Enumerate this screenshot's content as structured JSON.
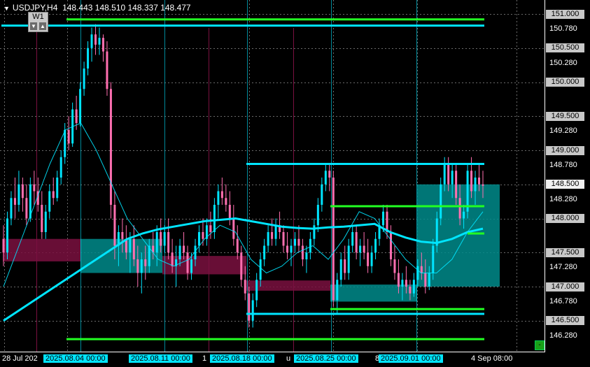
{
  "header": {
    "symbol": "USDJPY,H4",
    "ohlc": "148.443 148.510 148.337 148.477"
  },
  "timeframe_button": {
    "label": "W1",
    "down": "▼",
    "up": "▲"
  },
  "price_axis": {
    "boxed": [
      "151.000",
      "150.500",
      "150.000",
      "149.500",
      "149.000",
      "148.500",
      "148.000",
      "147.500",
      "147.000",
      "146.500"
    ],
    "plain": [
      "150.780",
      "150.280",
      "149.280",
      "148.780",
      "148.280",
      "147.280",
      "146.780",
      "146.280"
    ],
    "current": "148.500"
  },
  "time_axis": {
    "labels": [
      {
        "text": "28 Jul 202",
        "highlight": false
      },
      {
        "text": "2025.08.04 00:00",
        "highlight": true
      },
      {
        "text": "2025.08.11 00:00",
        "highlight": true
      },
      {
        "text": "1",
        "highlight": false
      },
      {
        "text": "2025.08.18 00:00",
        "highlight": true
      },
      {
        "text": "u",
        "highlight": false
      },
      {
        "text": "2025.08.25 00:00",
        "highlight": true
      },
      {
        "text": "8",
        "highlight": false
      },
      {
        "text": "2025.09.01 00:00",
        "highlight": true
      },
      {
        "text": "4 Sep 08:00",
        "highlight": false
      }
    ]
  },
  "corner_button": {
    "label": "-"
  },
  "colors": {
    "background": "#000000",
    "bull": "#00e5ff",
    "bear": "#ff6fb0",
    "support": "#22ff22",
    "box_teal": "#008b8b",
    "box_maroon": "#7a1040"
  },
  "chart_data": {
    "type": "candlestick",
    "symbol": "USDJPY",
    "timeframe": "H4",
    "ylim": [
      146.1,
      151.1
    ],
    "vertical_markers": [
      "2025.08.04 00:00",
      "2025.08.11 00:00",
      "2025.08.18 00:00",
      "2025.08.25 00:00",
      "2025.09.01 00:00"
    ],
    "horizontal_lines": [
      {
        "color": "#00e5ff",
        "price": 150.83
      },
      {
        "color": "#22ff22",
        "price": 150.92
      },
      {
        "color": "#00e5ff",
        "price": 148.8
      },
      {
        "color": "#00e5ff",
        "price": 146.6
      },
      {
        "color": "#22ff22",
        "price": 148.18
      },
      {
        "color": "#22ff22",
        "price": 147.78
      },
      {
        "color": "#22ff22",
        "price": 146.67
      },
      {
        "color": "#22ff22",
        "price": 146.23
      }
    ],
    "zones": [
      {
        "color": "#7a1040",
        "top": 147.7,
        "bottom": 147.37
      },
      {
        "color": "#008b8b",
        "top": 147.7,
        "bottom": 147.2
      },
      {
        "color": "#7a1040",
        "top": 147.45,
        "bottom": 147.18
      },
      {
        "color": "#7a1040",
        "top": 147.09,
        "bottom": 146.94
      },
      {
        "color": "#008b8b",
        "top": 147.03,
        "bottom": 146.78
      },
      {
        "color": "#008b8b",
        "top": 148.5,
        "bottom": 147.0
      }
    ],
    "candles": [
      [
        147.7,
        147.9,
        147.3,
        147.5
      ],
      [
        147.5,
        148.1,
        147.4,
        148.0
      ],
      [
        148.0,
        148.4,
        147.9,
        148.3
      ],
      [
        148.3,
        148.6,
        148.0,
        148.2
      ],
      [
        148.2,
        148.7,
        148.1,
        148.5
      ],
      [
        148.5,
        148.6,
        148.1,
        148.3
      ],
      [
        148.3,
        148.5,
        147.9,
        148.0
      ],
      [
        148.0,
        148.6,
        147.95,
        148.5
      ],
      [
        148.5,
        148.7,
        148.2,
        148.4
      ],
      [
        148.4,
        148.6,
        148.1,
        148.2
      ],
      [
        148.2,
        148.4,
        147.7,
        147.8
      ],
      [
        147.8,
        148.2,
        147.7,
        148.1
      ],
      [
        148.1,
        148.5,
        148.0,
        148.4
      ],
      [
        148.4,
        148.6,
        148.2,
        148.3
      ],
      [
        148.3,
        148.7,
        148.25,
        148.6
      ],
      [
        148.6,
        149.0,
        148.5,
        148.9
      ],
      [
        148.9,
        149.4,
        148.8,
        149.3
      ],
      [
        149.3,
        149.5,
        149.0,
        149.1
      ],
      [
        149.1,
        149.7,
        149.05,
        149.6
      ],
      [
        149.6,
        149.8,
        149.3,
        149.4
      ],
      [
        149.4,
        150.0,
        149.35,
        149.9
      ],
      [
        149.9,
        150.3,
        149.8,
        150.2
      ],
      [
        150.2,
        150.6,
        150.1,
        150.5
      ],
      [
        150.5,
        150.8,
        150.3,
        150.7
      ],
      [
        150.7,
        150.85,
        150.4,
        150.55
      ],
      [
        150.55,
        150.8,
        150.4,
        150.65
      ],
      [
        150.65,
        150.7,
        150.3,
        150.45
      ],
      [
        150.45,
        150.6,
        149.8,
        149.9
      ],
      [
        149.9,
        150.0,
        148.0,
        148.2
      ],
      [
        148.2,
        148.4,
        147.4,
        147.6
      ],
      [
        147.6,
        147.9,
        147.3,
        147.8
      ],
      [
        147.8,
        148.0,
        147.5,
        147.7
      ],
      [
        147.7,
        147.9,
        147.4,
        147.5
      ],
      [
        147.5,
        147.8,
        147.2,
        147.7
      ],
      [
        147.7,
        147.9,
        147.3,
        147.4
      ],
      [
        147.4,
        147.6,
        147.0,
        147.2
      ],
      [
        147.2,
        147.5,
        146.9,
        147.4
      ],
      [
        147.4,
        147.6,
        147.1,
        147.3
      ],
      [
        147.3,
        147.7,
        147.2,
        147.6
      ],
      [
        147.6,
        147.8,
        147.4,
        147.5
      ],
      [
        147.5,
        147.9,
        147.3,
        147.8
      ],
      [
        147.8,
        148.0,
        147.5,
        147.6
      ],
      [
        147.6,
        147.9,
        147.5,
        147.8
      ],
      [
        147.8,
        148.0,
        147.4,
        147.5
      ],
      [
        147.5,
        147.7,
        147.2,
        147.3
      ],
      [
        147.3,
        147.6,
        147.0,
        147.4
      ],
      [
        147.4,
        147.7,
        147.3,
        147.6
      ],
      [
        147.6,
        147.8,
        147.4,
        147.5
      ],
      [
        147.5,
        147.6,
        147.1,
        147.2
      ],
      [
        147.2,
        147.5,
        147.1,
        147.4
      ],
      [
        147.4,
        147.7,
        147.3,
        147.6
      ],
      [
        147.6,
        147.9,
        147.5,
        147.8
      ],
      [
        147.8,
        148.0,
        147.6,
        147.7
      ],
      [
        147.7,
        148.0,
        147.6,
        147.9
      ],
      [
        147.9,
        148.1,
        147.7,
        147.8
      ],
      [
        147.8,
        148.3,
        147.7,
        148.2
      ],
      [
        148.2,
        148.5,
        148.0,
        148.4
      ],
      [
        148.4,
        148.6,
        148.2,
        148.3
      ],
      [
        148.3,
        148.5,
        148.1,
        148.2
      ],
      [
        148.2,
        148.4,
        147.9,
        148.0
      ],
      [
        148.0,
        148.2,
        147.6,
        147.7
      ],
      [
        147.7,
        147.9,
        147.4,
        147.5
      ],
      [
        147.5,
        147.6,
        147.0,
        147.1
      ],
      [
        147.1,
        147.3,
        146.8,
        146.9
      ],
      [
        146.9,
        147.0,
        146.4,
        146.5
      ],
      [
        146.5,
        146.9,
        146.4,
        146.8
      ],
      [
        146.8,
        147.2,
        146.7,
        147.1
      ],
      [
        147.1,
        147.5,
        147.0,
        147.4
      ],
      [
        147.4,
        147.7,
        147.3,
        147.6
      ],
      [
        147.6,
        147.9,
        147.5,
        147.8
      ],
      [
        147.8,
        148.0,
        147.6,
        147.7
      ],
      [
        147.7,
        148.0,
        147.6,
        147.9
      ],
      [
        147.9,
        148.1,
        147.7,
        147.8
      ],
      [
        147.8,
        147.9,
        147.5,
        147.6
      ],
      [
        147.6,
        147.8,
        147.4,
        147.5
      ],
      [
        147.5,
        147.7,
        147.3,
        147.6
      ],
      [
        147.6,
        147.8,
        147.5,
        147.7
      ],
      [
        147.7,
        147.9,
        147.5,
        147.6
      ],
      [
        147.6,
        147.7,
        147.3,
        147.4
      ],
      [
        147.4,
        147.6,
        147.2,
        147.5
      ],
      [
        147.5,
        147.8,
        147.4,
        147.7
      ],
      [
        147.7,
        148.0,
        147.6,
        147.9
      ],
      [
        147.9,
        148.3,
        147.8,
        148.2
      ],
      [
        148.2,
        148.6,
        148.1,
        148.5
      ],
      [
        148.5,
        148.8,
        148.4,
        148.7
      ],
      [
        148.7,
        148.8,
        148.4,
        148.6
      ],
      [
        148.6,
        148.7,
        146.7,
        146.8
      ],
      [
        146.8,
        147.2,
        146.6,
        147.1
      ],
      [
        147.1,
        147.5,
        147.0,
        147.4
      ],
      [
        147.4,
        147.6,
        147.1,
        147.2
      ],
      [
        147.2,
        147.7,
        147.1,
        147.6
      ],
      [
        147.6,
        147.9,
        147.5,
        147.8
      ],
      [
        147.8,
        147.9,
        147.4,
        147.5
      ],
      [
        147.5,
        147.7,
        147.3,
        147.6
      ],
      [
        147.6,
        147.8,
        147.4,
        147.5
      ],
      [
        147.5,
        147.7,
        147.2,
        147.3
      ],
      [
        147.3,
        147.6,
        147.2,
        147.5
      ],
      [
        147.5,
        147.8,
        147.4,
        147.7
      ],
      [
        147.7,
        148.0,
        147.6,
        147.9
      ],
      [
        147.9,
        148.2,
        147.8,
        148.1
      ],
      [
        148.1,
        148.2,
        147.7,
        147.8
      ],
      [
        147.8,
        147.9,
        147.3,
        147.4
      ],
      [
        147.4,
        147.6,
        147.1,
        147.2
      ],
      [
        147.2,
        147.4,
        146.9,
        147.0
      ],
      [
        147.0,
        147.2,
        146.8,
        147.1
      ],
      [
        147.1,
        147.3,
        146.9,
        147.0
      ],
      [
        147.0,
        147.1,
        146.8,
        146.9
      ],
      [
        146.9,
        147.2,
        146.85,
        147.1
      ],
      [
        147.1,
        147.4,
        147.0,
        147.3
      ],
      [
        147.3,
        147.5,
        147.1,
        147.2
      ],
      [
        147.2,
        147.4,
        146.9,
        147.0
      ],
      [
        147.0,
        147.3,
        146.95,
        147.2
      ],
      [
        147.2,
        147.7,
        147.1,
        147.6
      ],
      [
        147.6,
        148.1,
        147.5,
        148.0
      ],
      [
        148.0,
        148.6,
        147.9,
        148.5
      ],
      [
        148.5,
        148.9,
        148.4,
        148.8
      ],
      [
        148.8,
        148.9,
        148.4,
        148.5
      ],
      [
        148.5,
        148.8,
        148.3,
        148.7
      ],
      [
        148.7,
        148.8,
        148.2,
        148.3
      ],
      [
        148.3,
        148.5,
        147.9,
        148.0
      ],
      [
        148.0,
        148.2,
        147.85,
        148.1
      ],
      [
        148.1,
        148.8,
        148.0,
        148.7
      ],
      [
        148.7,
        148.9,
        148.3,
        148.4
      ],
      [
        148.4,
        148.7,
        148.2,
        148.6
      ],
      [
        148.6,
        148.8,
        148.4,
        148.5
      ],
      [
        148.5,
        148.7,
        148.3,
        148.48
      ]
    ],
    "ma_long": [
      146.5,
      146.65,
      146.8,
      146.95,
      147.1,
      147.25,
      147.4,
      147.55,
      147.7,
      147.78,
      147.84,
      147.88,
      147.92,
      147.96,
      147.98,
      148.0,
      147.96,
      147.92,
      147.88,
      147.86,
      147.85,
      147.87,
      147.88,
      147.9,
      147.92,
      147.8,
      147.72,
      147.66,
      147.64,
      147.7,
      147.8,
      147.85
    ],
    "ma_short": [
      147.0,
      147.6,
      148.2,
      148.8,
      149.3,
      149.4,
      149.0,
      148.5,
      148.0,
      147.7,
      147.4,
      147.3,
      147.4,
      147.7,
      147.9,
      147.8,
      147.4,
      147.2,
      147.3,
      147.5,
      147.6,
      147.4,
      147.7,
      148.1,
      148.0,
      147.7,
      147.4,
      147.2,
      147.2,
      147.4,
      147.8,
      148.1
    ]
  }
}
